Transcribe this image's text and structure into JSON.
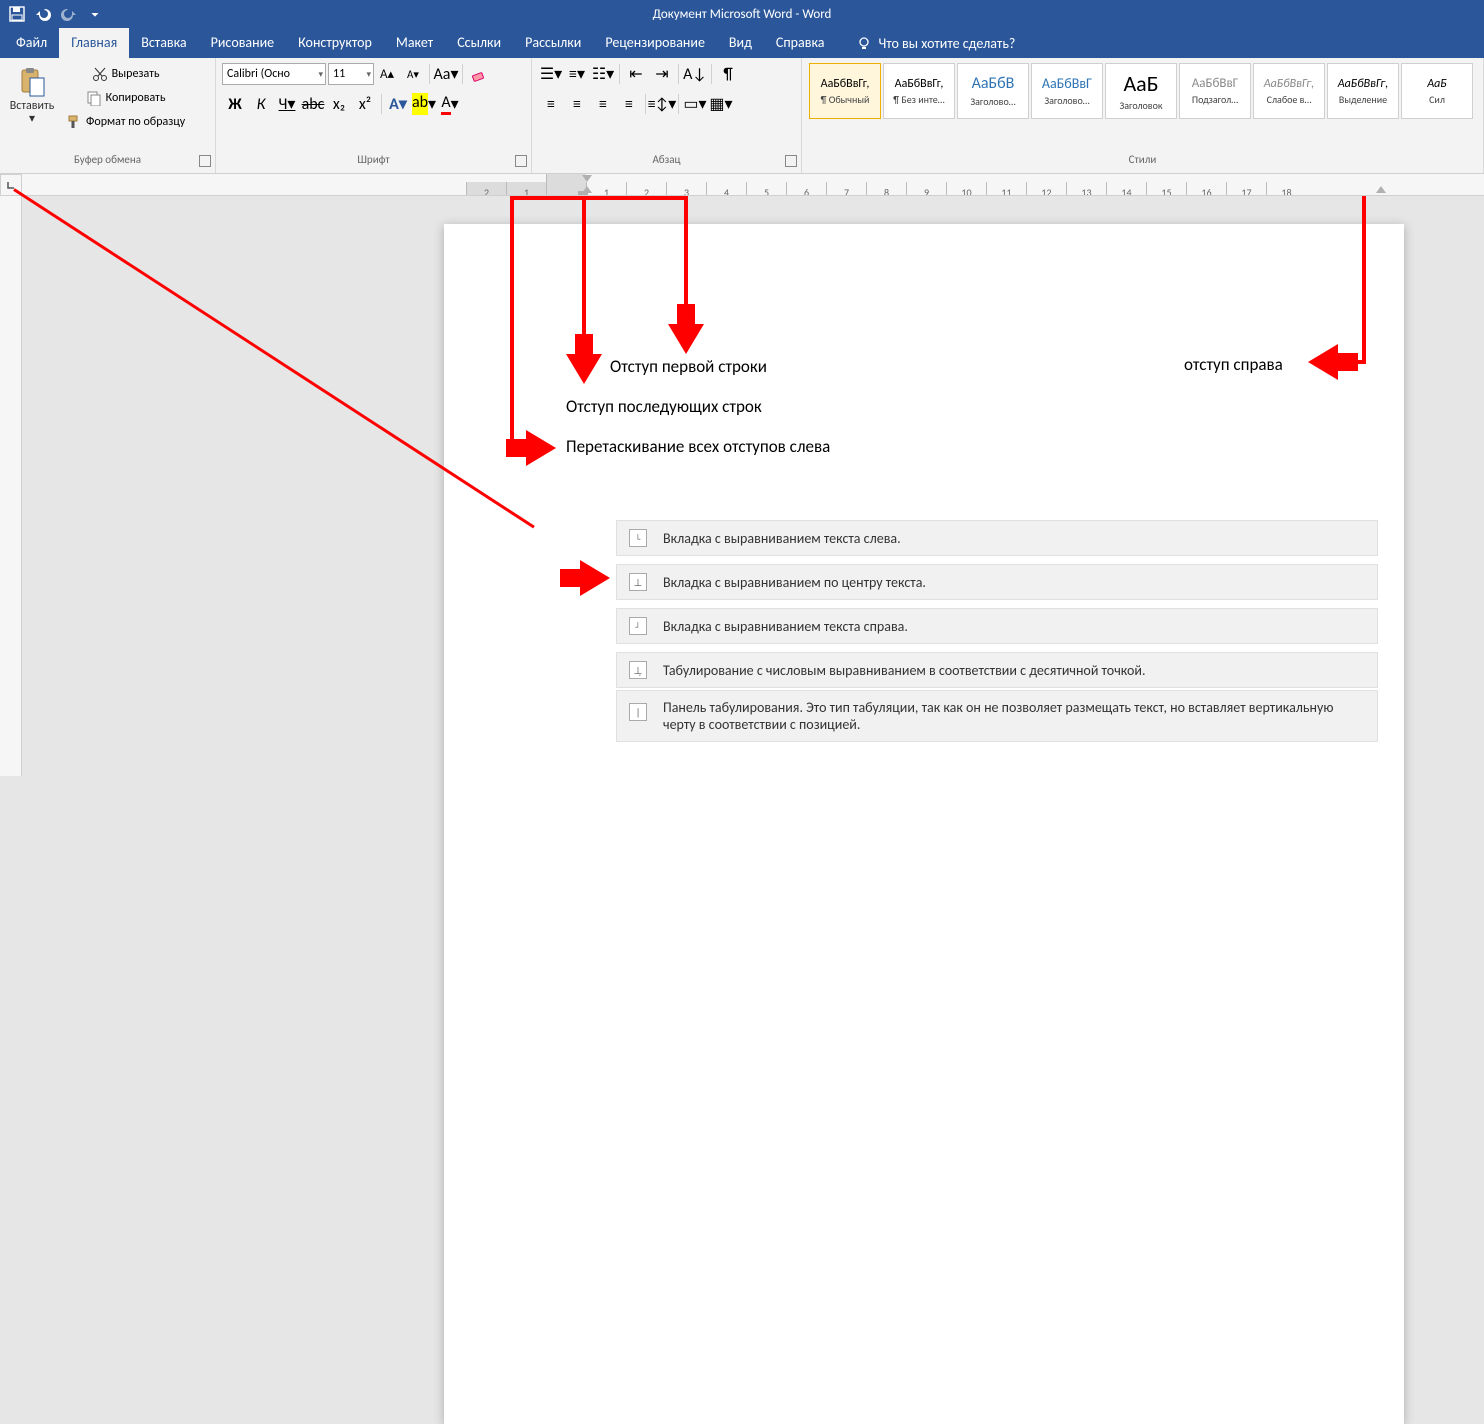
{
  "title_bar": "Документ Microsoft Word  -  Word",
  "tabs": {
    "file": "Файл",
    "home": "Главная",
    "insert": "Вставка",
    "draw": "Рисование",
    "design": "Конструктор",
    "layout": "Макет",
    "references": "Ссылки",
    "mailings": "Рассылки",
    "review": "Рецензирование",
    "view": "Вид",
    "help": "Справка",
    "tell_me": "Что вы хотите сделать?"
  },
  "clipboard": {
    "paste": "Вставить",
    "cut": "Вырезать",
    "copy": "Копировать",
    "format_painter": "Формат по образцу",
    "group": "Буфер обмена"
  },
  "font": {
    "name": "Calibri (Осно",
    "size": "11",
    "group": "Шрифт",
    "bold": "Ж",
    "italic": "К",
    "underline": "Ч",
    "strike": "abc",
    "sub": "x₂",
    "sup": "x²",
    "case": "Aa",
    "clear": "⌫"
  },
  "paragraph": {
    "group": "Абзац"
  },
  "styles": {
    "group": "Стили",
    "items": [
      {
        "sample": "АаБбВвГг,",
        "name": "¶ Обычный",
        "sel": true,
        "color": "#000",
        "size": "12px"
      },
      {
        "sample": "АаБбВвГг,",
        "name": "¶ Без инте…",
        "color": "#000",
        "size": "12px"
      },
      {
        "sample": "АаБбВ",
        "name": "Заголово…",
        "color": "#2e74b5",
        "size": "16px"
      },
      {
        "sample": "АаБбВвГ",
        "name": "Заголово…",
        "color": "#2e74b5",
        "size": "14px"
      },
      {
        "sample": "АаБ",
        "name": "Заголовок",
        "color": "#000",
        "size": "22px"
      },
      {
        "sample": "АаБбВвГ",
        "name": "Подзагол…",
        "color": "#888",
        "size": "13px"
      },
      {
        "sample": "АаБбВвГг,",
        "name": "Слабое в…",
        "color": "#888",
        "size": "12px",
        "italic": true
      },
      {
        "sample": "АаБбВвГг,",
        "name": "Выделение",
        "color": "#000",
        "size": "12px",
        "italic": true
      },
      {
        "sample": "АаБ",
        "name": "Сил",
        "color": "#000",
        "size": "12px",
        "italic": true
      }
    ]
  },
  "ruler_numbers": [
    "2",
    "1",
    "",
    "1",
    "2",
    "3",
    "4",
    "5",
    "6",
    "7",
    "8",
    "9",
    "10",
    "11",
    "12",
    "13",
    "14",
    "15",
    "16",
    "17",
    "18"
  ],
  "annotations": {
    "first_line": "Отступ первой строки",
    "hanging": "Отступ последующих строк",
    "drag_all": "Перетаскивание всех отступов слева",
    "right_indent": "отступ справа"
  },
  "tab_types": {
    "left": "Вкладка с выравниванием текста слева.",
    "center": "Вкладка с выравниванием по центру текста.",
    "right": "Вкладка с выравниванием текста справа.",
    "decimal": "Табулирование с числовым выравниванием в соответствии с десятичной точкой.",
    "bar": "Панель табулирования. Это тип табуляции, так как он не позволяет размещать текст, но вставляет вертикальную черту в соответствии с позицией."
  }
}
